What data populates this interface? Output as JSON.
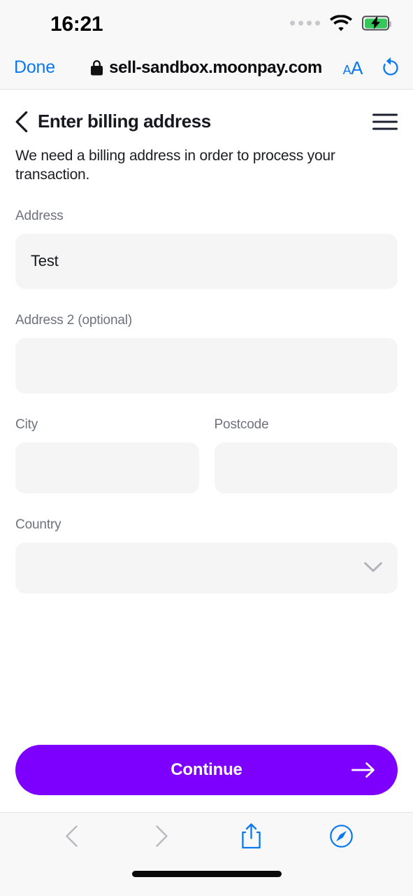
{
  "status_bar": {
    "time": "16:21",
    "icons": [
      "cellular-dots-icon",
      "wifi-icon",
      "battery-charging-icon"
    ],
    "battery_charging": true,
    "battery_color": "#34C759"
  },
  "browser_bar": {
    "done_label": "Done",
    "lock_icon": "lock-icon",
    "url": "sell-sandbox.moonpay.com",
    "text_size_label_small": "A",
    "text_size_label_large": "A",
    "reload_icon": "reload-icon",
    "accent_color": "#0A78F0"
  },
  "page": {
    "back_icon": "chevron-left-icon",
    "title": "Enter billing address",
    "menu_icon": "hamburger-menu-icon",
    "subtitle": "We need a billing address in order to process your transaction.",
    "fields": {
      "address": {
        "label": "Address",
        "value": "Test",
        "placeholder": ""
      },
      "address2": {
        "label": "Address 2 (optional)",
        "value": "",
        "placeholder": ""
      },
      "city": {
        "label": "City",
        "value": "",
        "placeholder": ""
      },
      "postcode": {
        "label": "Postcode",
        "value": "",
        "placeholder": ""
      },
      "country": {
        "label": "Country",
        "value": "",
        "placeholder": "",
        "chevron_icon": "chevron-down-icon"
      }
    },
    "cta": {
      "label": "Continue",
      "arrow_icon": "arrow-right-icon",
      "background": "#7D00FF",
      "text_color": "#FFFFFF"
    }
  },
  "toolbar": {
    "back_icon": "chevron-left-icon",
    "forward_icon": "chevron-right-icon",
    "share_icon": "share-icon",
    "tabs_icon": "safari-compass-icon",
    "back_enabled": false,
    "forward_enabled": false,
    "accent_color": "#0A78F0",
    "disabled_color": "#B9B9BE"
  },
  "home_indicator": "home-indicator"
}
